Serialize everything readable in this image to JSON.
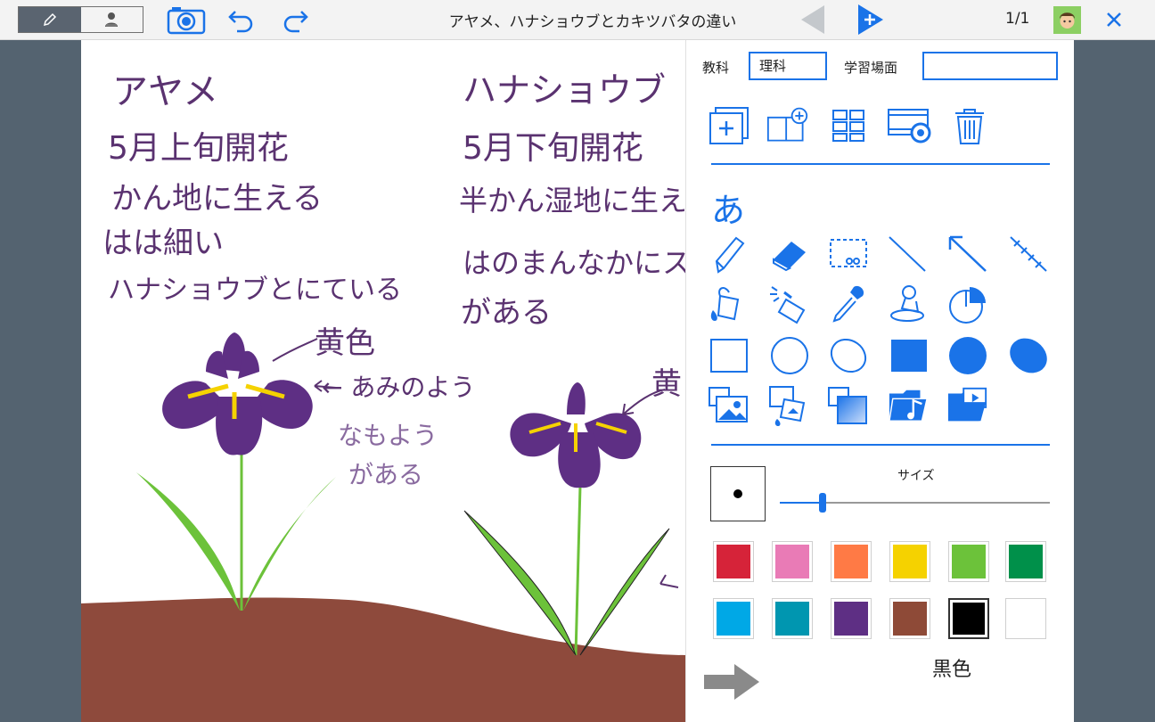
{
  "header": {
    "title": "アヤメ、ハナショウブとカキツバタの違い",
    "page_indicator": "1/1"
  },
  "canvas": {
    "left_text": [
      "アヤメ",
      "5月上旬開花",
      "かん地に生える",
      "はは細い",
      "ハナショウブとにている"
    ],
    "right_text": [
      "ハナショウブ",
      "5月下旬開花",
      "半かん湿地に生え",
      "はのまんなかにス",
      "がある"
    ],
    "annotations": {
      "yellow": "黄色",
      "net": "← あみのよう",
      "pattern1": "なもよう",
      "pattern2": "がある",
      "yellow_right": "黄"
    }
  },
  "panel": {
    "subject_label": "教科",
    "subject_value": "理科",
    "scene_label": "学習場面",
    "scene_value": "",
    "text_tool": "あ",
    "size_label": "サイズ",
    "size_value": 0.16,
    "selected_color_name": "黒色",
    "colors": [
      "#d62339",
      "#e97bb6",
      "#ff7a45",
      "#f5d200",
      "#6cc23a",
      "#00904a",
      "#00a8e6",
      "#0096b0",
      "#5e2f84",
      "#8e4a37",
      "#000000",
      "#ffffff"
    ]
  }
}
